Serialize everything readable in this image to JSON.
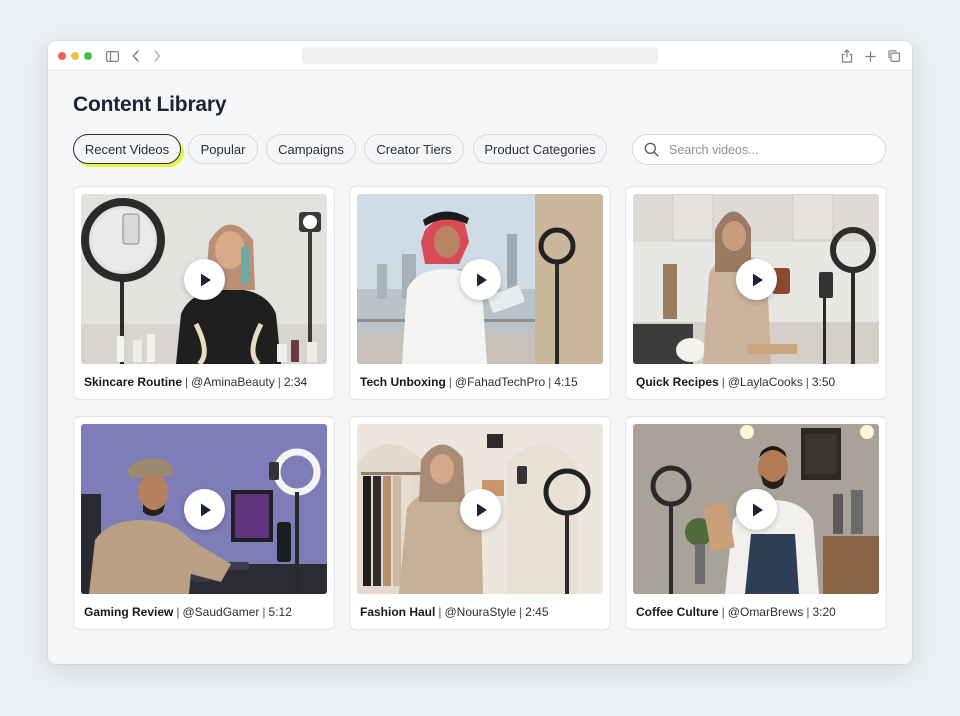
{
  "page": {
    "title": "Content Library"
  },
  "browser": {
    "url": ""
  },
  "filters": [
    {
      "label": "Recent Videos",
      "active": true
    },
    {
      "label": "Popular",
      "active": false
    },
    {
      "label": "Campaigns",
      "active": false
    },
    {
      "label": "Creator Tiers",
      "active": false
    },
    {
      "label": "Product Categories",
      "active": false
    }
  ],
  "search": {
    "placeholder": "Search videos..."
  },
  "videos": [
    {
      "title": "Skincare Routine",
      "creator": "@AminaBeauty",
      "duration": "2:34"
    },
    {
      "title": "Tech Unboxing",
      "creator": "@FahadTechPro",
      "duration": "4:15"
    },
    {
      "title": "Quick Recipes",
      "creator": "@LaylaCooks",
      "duration": "3:50"
    },
    {
      "title": "Gaming Review",
      "creator": "@SaudGamer",
      "duration": "5:12"
    },
    {
      "title": "Fashion Haul",
      "creator": "@NouraStyle",
      "duration": "2:45"
    },
    {
      "title": "Coffee Culture",
      "creator": "@OmarBrews",
      "duration": "3:20"
    }
  ],
  "colors": {
    "accent_underline": "#e6f244",
    "play_icon": "#1d2433"
  },
  "icons": [
    "sidebar-icon",
    "back-icon",
    "forward-icon",
    "share-icon",
    "new-tab-icon",
    "tabs-icon",
    "search-icon",
    "play-icon"
  ]
}
